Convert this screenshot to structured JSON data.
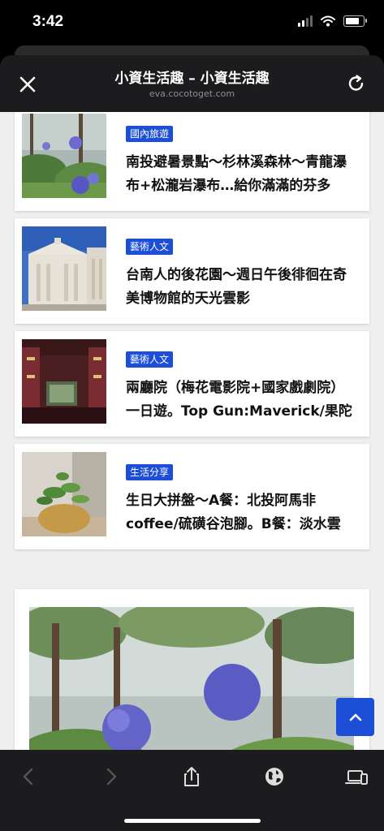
{
  "status_bar": {
    "time": "3:42"
  },
  "header": {
    "title": "小資生活趣 – 小資生活趣",
    "url": "eva.cocotoget.com"
  },
  "articles": [
    {
      "category": "國內旅遊",
      "title": "南投避暑景點～杉林溪森林～青龍瀑布+松瀧岩瀑布…給你滿滿的芬多",
      "thumbnail": "agapanthus-flower-photo"
    },
    {
      "category": "藝術人文",
      "title": "台南人的後花園～週日午後徘徊在奇美博物館的天光雲影",
      "thumbnail": "museum-building-photo"
    },
    {
      "category": "藝術人文",
      "title": "兩廳院（梅花電影院+國家戲劇院）一日遊。Top Gun:Maverick/果陀",
      "thumbnail": "theater-screen-photo"
    },
    {
      "category": "生活分享",
      "title": "生日大拼盤～A餐：北投阿馬非coffee/硫磺谷泡腳。B餐：淡水雲",
      "thumbnail": "plant-vase-photo"
    }
  ],
  "featured": {
    "image": "forest-flowers-photo"
  },
  "toolbar": {
    "icons": [
      "back-arrow-icon",
      "forward-arrow-icon",
      "share-icon",
      "globe-icon",
      "devices-icon"
    ]
  },
  "colors": {
    "accent": "#1d4ed8",
    "header_bg": "#1c1c1e",
    "page_bg": "#efefef"
  }
}
